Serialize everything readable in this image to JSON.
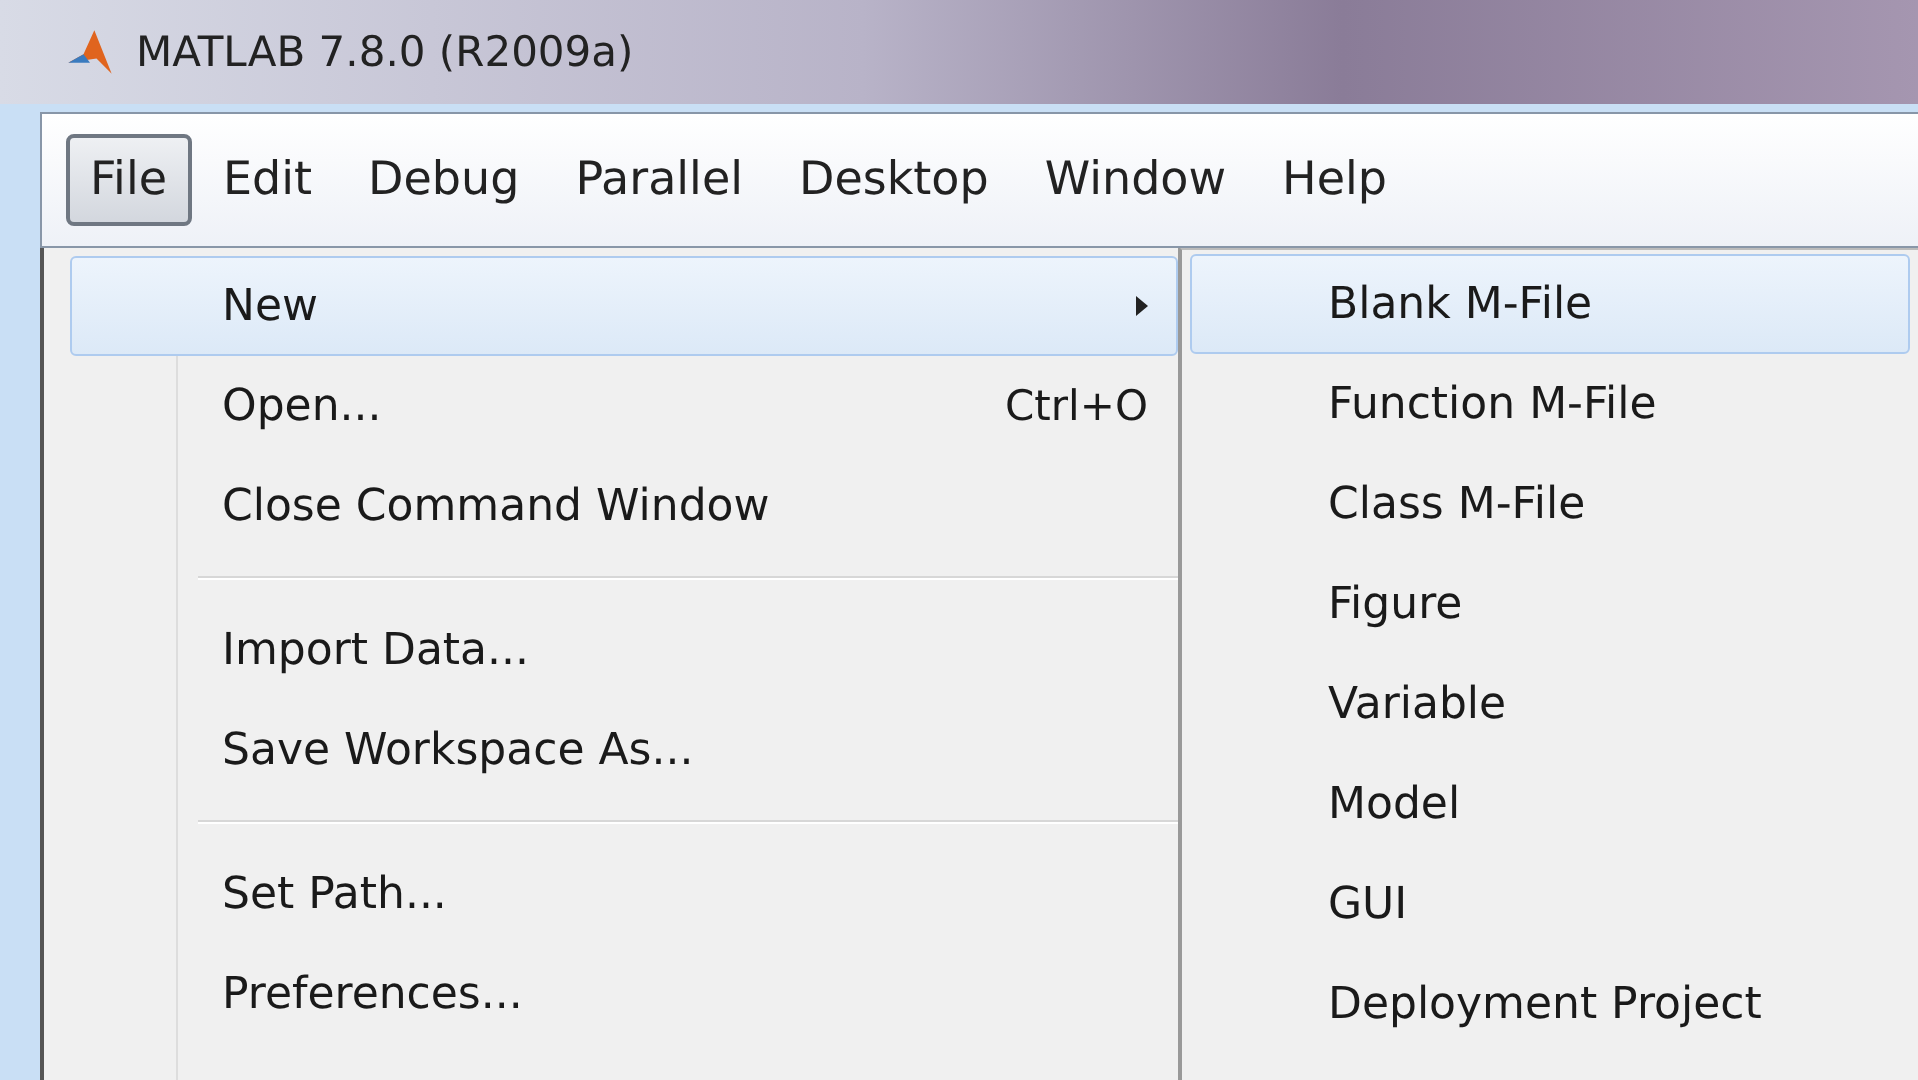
{
  "window": {
    "title": "MATLAB  7.8.0 (R2009a)"
  },
  "menu_bar": [
    {
      "label": "File",
      "selected": true
    },
    {
      "label": "Edit",
      "selected": false
    },
    {
      "label": "Debug",
      "selected": false
    },
    {
      "label": "Parallel",
      "selected": false
    },
    {
      "label": "Desktop",
      "selected": false
    },
    {
      "label": "Window",
      "selected": false
    },
    {
      "label": "Help",
      "selected": false
    }
  ],
  "file_menu": [
    {
      "kind": "item",
      "label": "New",
      "has_submenu": true,
      "selected": true
    },
    {
      "kind": "item",
      "label": "Open...",
      "shortcut": "Ctrl+O",
      "selected": false
    },
    {
      "kind": "item",
      "label": "Close Command Window",
      "selected": false
    },
    {
      "kind": "separator"
    },
    {
      "kind": "item",
      "label": "Import Data...",
      "selected": false
    },
    {
      "kind": "item",
      "label": "Save Workspace As...",
      "selected": false
    },
    {
      "kind": "separator"
    },
    {
      "kind": "item",
      "label": "Set Path...",
      "selected": false
    },
    {
      "kind": "item",
      "label": "Preferences...",
      "selected": false
    }
  ],
  "new_submenu": [
    {
      "label": "Blank M-File",
      "selected": true
    },
    {
      "label": "Function M-File",
      "selected": false
    },
    {
      "label": "Class M-File",
      "selected": false
    },
    {
      "label": "Figure",
      "selected": false
    },
    {
      "label": "Variable",
      "selected": false
    },
    {
      "label": "Model",
      "selected": false
    },
    {
      "label": "GUI",
      "selected": false
    },
    {
      "label": "Deployment Project",
      "selected": false
    }
  ]
}
